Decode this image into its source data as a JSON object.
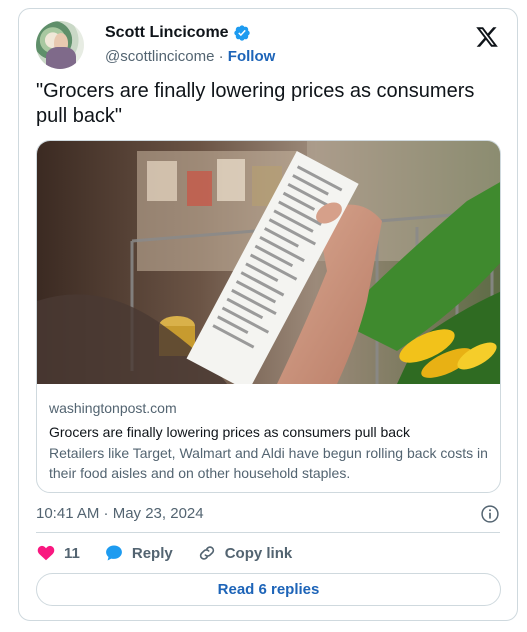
{
  "author": {
    "name": "Scott Lincicome",
    "handle": "@scottlincicome",
    "separator": "·",
    "follow_label": "Follow",
    "verified_color": "#1d9bf0"
  },
  "tweet": {
    "text": "\"Grocers are finally lowering prices as consumers pull back\""
  },
  "link_card": {
    "domain": "washingtonpost.com",
    "title": "Grocers are finally lowering prices as consumers pull back",
    "description": "Retailers like Target, Walmart and Aldi have begun rolling back costs in their food aisles and on other household staples."
  },
  "timestamp": "10:41 AM · May 23, 2024",
  "actions": {
    "like_count": "11",
    "like_color": "#f91880",
    "reply_label": "Reply",
    "reply_color": "#1d9bf0",
    "copy_label": "Copy link"
  },
  "read_replies_label": "Read 6 replies",
  "colors": {
    "link_blue": "#1d64b8",
    "secondary_text": "#536471",
    "border": "#cfd9de"
  },
  "icons": [
    "verified-badge-icon",
    "x-logo-icon",
    "info-icon",
    "heart-icon",
    "reply-bubble-icon",
    "link-icon"
  ]
}
